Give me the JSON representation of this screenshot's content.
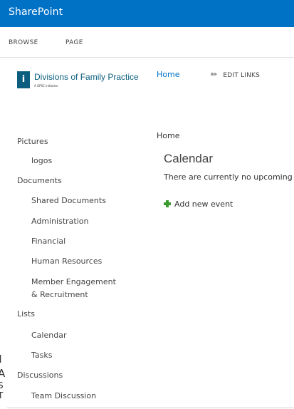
{
  "suitebar": {
    "brand": "SharePoint"
  },
  "ribbon": {
    "tabs": [
      "BROWSE",
      "PAGE"
    ]
  },
  "site": {
    "logo_name": "Divisions of Family Practice",
    "logo_tagline": "A GPSC initiative"
  },
  "topnav": {
    "home": "Home",
    "edit_links": "EDIT LINKS"
  },
  "quicklaunch": {
    "items": [
      {
        "label": "Pictures",
        "level": "heading"
      },
      {
        "label": "logos",
        "level": "sub"
      },
      {
        "label": "Documents",
        "level": "heading"
      },
      {
        "label": "Shared Documents",
        "level": "sub"
      },
      {
        "label": "Administration",
        "level": "sub"
      },
      {
        "label": "Financial",
        "level": "sub"
      },
      {
        "label": "Human Resources",
        "level": "sub"
      },
      {
        "label": "Member Engagement",
        "level": "sub"
      },
      {
        "label": "& Recruitment",
        "level": "sub"
      },
      {
        "label": "Lists",
        "level": "heading"
      },
      {
        "label": "Calendar",
        "level": "sub"
      },
      {
        "label": "Tasks",
        "level": "sub"
      },
      {
        "label": "Discussions",
        "level": "heading"
      },
      {
        "label": "Team Discussion",
        "level": "sub"
      }
    ]
  },
  "main": {
    "breadcrumb": "Home",
    "title": "Calendar",
    "empty_message": "There are currently no upcoming",
    "add_new": "Add new event"
  },
  "background_fragment": [
    "I",
    "A",
    "S",
    "T"
  ]
}
